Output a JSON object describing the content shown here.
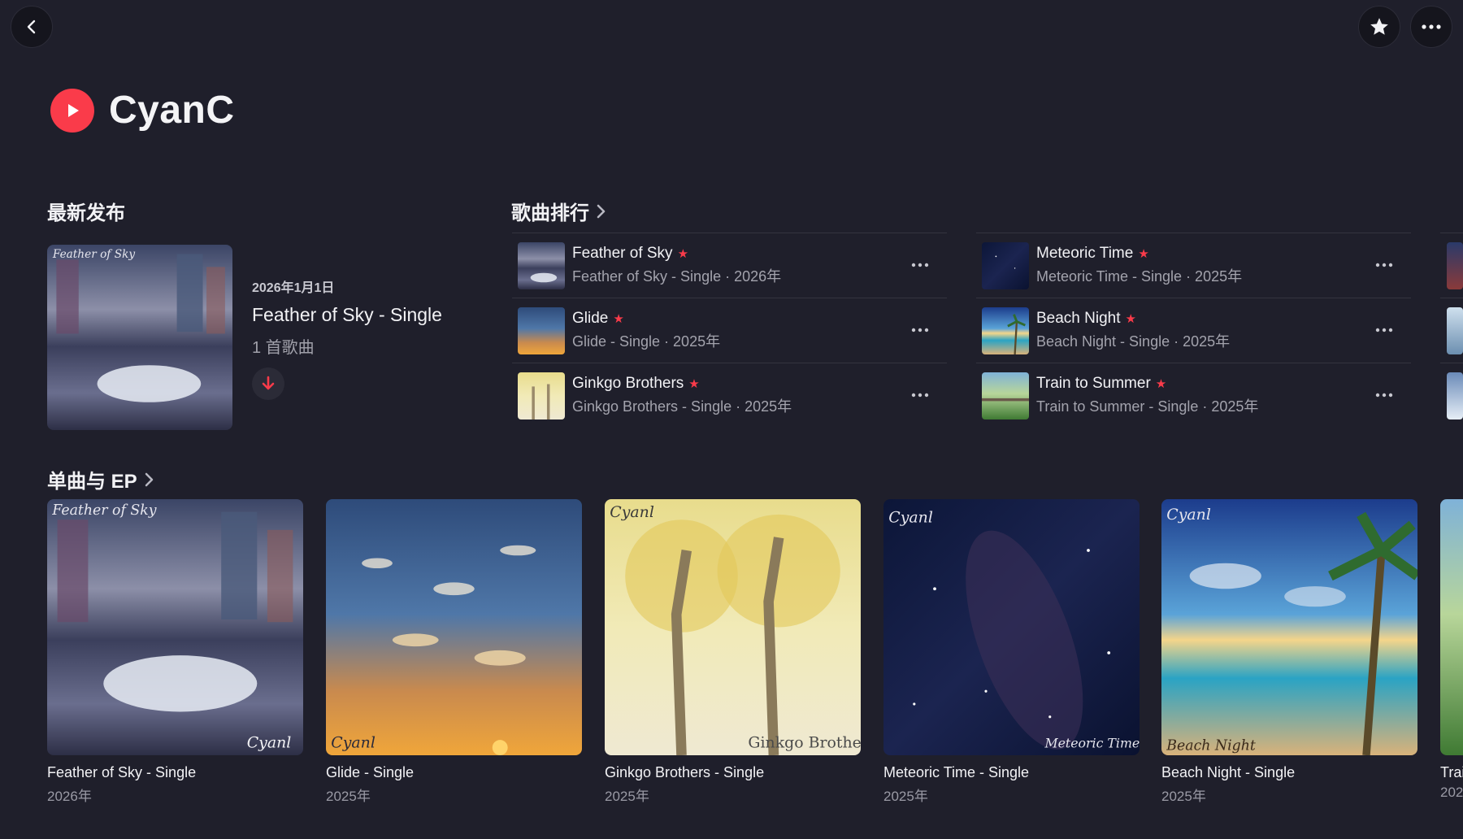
{
  "artist": {
    "name": "CyanC"
  },
  "sections": {
    "latest": "最新发布",
    "top_songs": "歌曲排行",
    "singles": "单曲与 EP"
  },
  "latest": {
    "date": "2026年1月1日",
    "title": "Feather of Sky - Single",
    "count": "1 首歌曲"
  },
  "songs": [
    {
      "title": "Feather of Sky",
      "sub": "Feather of Sky - Single · 2026年"
    },
    {
      "title": "Glide",
      "sub": "Glide - Single · 2025年"
    },
    {
      "title": "Ginkgo Brothers",
      "sub": "Ginkgo Brothers - Single · 2025年"
    },
    {
      "title": "Meteoric Time",
      "sub": "Meteoric Time - Single · 2025年"
    },
    {
      "title": "Beach Night",
      "sub": "Beach Night - Single · 2025年"
    },
    {
      "title": "Train to Summer",
      "sub": "Train to Summer - Single · 2025年"
    }
  ],
  "singles": [
    {
      "title": "Feather of Sky - Single",
      "year": "2026年"
    },
    {
      "title": "Glide - Single",
      "year": "2025年"
    },
    {
      "title": "Ginkgo Brothers - Single",
      "year": "2025年"
    },
    {
      "title": "Meteoric Time - Single",
      "year": "2025年"
    },
    {
      "title": "Beach Night - Single",
      "year": "2025年"
    },
    {
      "title": "Trai",
      "year": "202"
    }
  ],
  "art_text": {
    "feather": "Feather of Sky",
    "ginkgo": "Ginkgo Brothers",
    "meteoric": "Meteoric Time",
    "beach": "Beach Night",
    "signature": "Cyanl"
  },
  "colors": {
    "accent": "#fa3b4a",
    "background": "#1f1f2b"
  },
  "icons": [
    "back-icon",
    "star-icon",
    "more-icon",
    "play-icon",
    "chevron-right-icon",
    "download-arrow-icon"
  ]
}
